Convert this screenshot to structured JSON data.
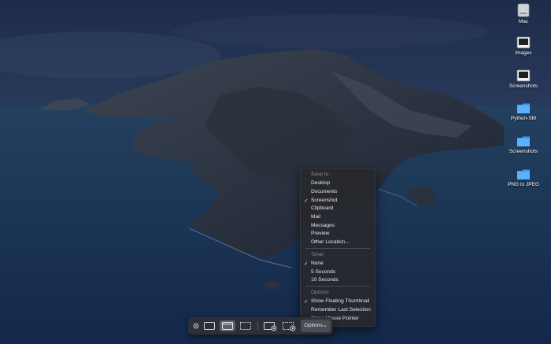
{
  "desktop": {
    "icons": [
      {
        "label": "Mac",
        "type": "hard-drive-icon"
      },
      {
        "label": "Images",
        "type": "screenshot-file-icon"
      },
      {
        "label": "Screenshots",
        "type": "screenshot-file-icon"
      },
      {
        "label": "Python-SM",
        "type": "folder-icon"
      },
      {
        "label": "Screenshots",
        "type": "folder-icon"
      },
      {
        "label": "PNG to JPEG",
        "type": "folder-icon"
      }
    ],
    "folder_color": "#3a9df5"
  },
  "options_menu": {
    "save_to_header": "Save to",
    "save_to": [
      "Desktop",
      "Documents",
      "Screenshot",
      "Clipboard",
      "Mail",
      "Messages",
      "Preview",
      "Other Location..."
    ],
    "save_to_checked": "Screenshot",
    "timer_header": "Timer",
    "timer": [
      "None",
      "5 Seconds",
      "10 Seconds"
    ],
    "timer_checked": "None",
    "options_header": "Options",
    "options": [
      "Show Floating Thumbnail",
      "Remember Last Selection",
      "Show Mouse Pointer"
    ],
    "options_checked": [
      "Show Floating Thumbnail"
    ],
    "check_glyph": "✓"
  },
  "toolbar": {
    "buttons": [
      "close-icon",
      "capture-entire-screen-icon",
      "capture-window-icon",
      "capture-selection-icon",
      "record-entire-screen-icon",
      "record-selection-icon"
    ],
    "active_button": "capture-window-icon",
    "options_label": "Options",
    "options_chevron": "⌄"
  }
}
